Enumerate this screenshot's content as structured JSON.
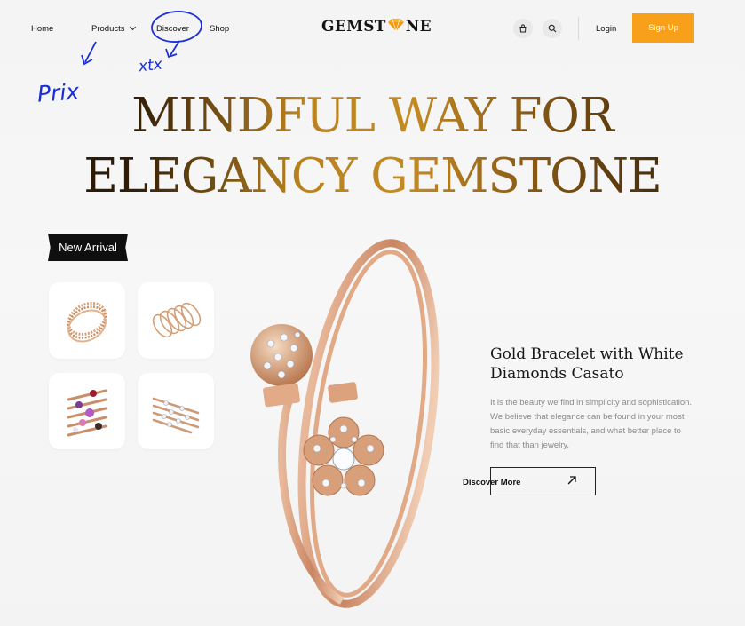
{
  "nav": {
    "home": "Home",
    "products": "Products",
    "discover": "Discover",
    "shop": "Shop"
  },
  "logo": {
    "pre": "GEMST",
    "post": "NE"
  },
  "header": {
    "login": "Login",
    "signup": "Sign Up"
  },
  "hero": {
    "line1": "MINDFUL WAY FOR",
    "line2": "ELEGANCY GEMSTONE"
  },
  "new_arrival": {
    "label": "New Arrival"
  },
  "product": {
    "title": "Gold Bracelet with White Diamonds Casato",
    "description": "It is the beauty we find in simplicity and sophistication. We believe that elegance can be found in your most basic everyday essentials, and what better place to find that than jewelry.",
    "cta": "Discover More"
  },
  "annotations": {
    "note1": "Prix",
    "note2": "xtx"
  },
  "colors": {
    "accent": "#f9a01b",
    "gold": "#c48b23",
    "ink": "#1e1306",
    "pen": "#1a2fd6"
  },
  "icons": [
    "chevron-down-icon",
    "diamond-icon",
    "shopping-bag-icon",
    "search-icon",
    "arrow-up-right-icon"
  ]
}
